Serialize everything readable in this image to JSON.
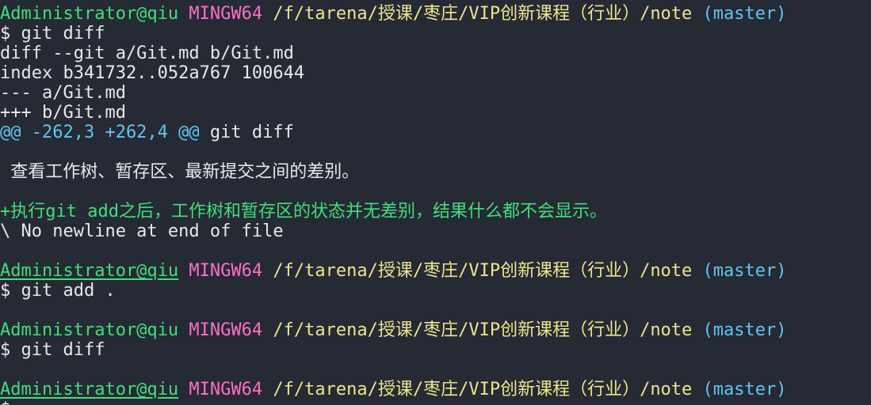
{
  "colors": {
    "background": "#262a35",
    "default_text": "#e8e8e8",
    "prompt_user": "#3fe07a",
    "prompt_msystem": "#ff6ec7",
    "prompt_path": "#eee58a",
    "prompt_branch": "#5ec8ee",
    "diff_meta": "#e8e8e8",
    "diff_hunk": "#5ec8ee",
    "diff_added": "#3fe07a"
  },
  "lines": [
    {
      "kind": "prompt",
      "segments": [
        {
          "text": "Administrator@qiu",
          "color": "prompt_user",
          "underline": false
        },
        {
          "text": " ",
          "color": "default_text"
        },
        {
          "text": "MINGW64",
          "color": "prompt_msystem"
        },
        {
          "text": " ",
          "color": "default_text"
        },
        {
          "text": "/f/tarena/授课/枣庄/VIP创新课程（行业）/note",
          "color": "prompt_path"
        },
        {
          "text": " ",
          "color": "default_text"
        },
        {
          "text": "(master)",
          "color": "prompt_branch"
        }
      ]
    },
    {
      "kind": "command",
      "segments": [
        {
          "text": "$ git diff",
          "color": "default_text"
        }
      ]
    },
    {
      "kind": "diff-meta",
      "segments": [
        {
          "text": "diff --git a/Git.md b/Git.md",
          "color": "diff_meta"
        }
      ]
    },
    {
      "kind": "diff-meta",
      "segments": [
        {
          "text": "index b341732..052a767 100644",
          "color": "diff_meta"
        }
      ]
    },
    {
      "kind": "diff-meta",
      "segments": [
        {
          "text": "--- a/Git.md",
          "color": "diff_meta"
        }
      ]
    },
    {
      "kind": "diff-meta",
      "segments": [
        {
          "text": "+++ b/Git.md",
          "color": "diff_meta"
        }
      ]
    },
    {
      "kind": "diff-hunk",
      "segments": [
        {
          "text": "@@ -262,3 +262,4 @@",
          "color": "diff_hunk"
        },
        {
          "text": " git diff",
          "color": "default_text"
        }
      ]
    },
    {
      "kind": "blank",
      "segments": []
    },
    {
      "kind": "context",
      "segments": [
        {
          "text": " 查看工作树、暂存区、最新提交之间的差别。",
          "color": "default_text"
        }
      ]
    },
    {
      "kind": "blank",
      "segments": []
    },
    {
      "kind": "added",
      "segments": [
        {
          "text": "+执行git add之后，工作树和暂存区的状态并无差别，结果什么都不会显示。",
          "color": "diff_added"
        }
      ]
    },
    {
      "kind": "note",
      "segments": [
        {
          "text": "\\ No newline at end of file",
          "color": "default_text"
        }
      ]
    },
    {
      "kind": "blank",
      "segments": []
    },
    {
      "kind": "prompt",
      "segments": [
        {
          "text": "Administrator@qiu",
          "color": "prompt_user",
          "underline": true
        },
        {
          "text": " ",
          "color": "default_text"
        },
        {
          "text": "MINGW64",
          "color": "prompt_msystem"
        },
        {
          "text": " ",
          "color": "default_text"
        },
        {
          "text": "/f/tarena/授课/枣庄/VIP创新课程（行业）/note",
          "color": "prompt_path"
        },
        {
          "text": " ",
          "color": "default_text"
        },
        {
          "text": "(master)",
          "color": "prompt_branch"
        }
      ]
    },
    {
      "kind": "command",
      "segments": [
        {
          "text": "$ git add .",
          "color": "default_text"
        }
      ]
    },
    {
      "kind": "blank",
      "segments": []
    },
    {
      "kind": "prompt",
      "segments": [
        {
          "text": "Administrator@qiu",
          "color": "prompt_user",
          "underline": false
        },
        {
          "text": " ",
          "color": "default_text"
        },
        {
          "text": "MINGW64",
          "color": "prompt_msystem"
        },
        {
          "text": " ",
          "color": "default_text"
        },
        {
          "text": "/f/tarena/授课/枣庄/VIP创新课程（行业）/note",
          "color": "prompt_path"
        },
        {
          "text": " ",
          "color": "default_text"
        },
        {
          "text": "(master)",
          "color": "prompt_branch"
        }
      ]
    },
    {
      "kind": "command",
      "segments": [
        {
          "text": "$ git diff",
          "color": "default_text"
        }
      ]
    },
    {
      "kind": "blank",
      "segments": []
    },
    {
      "kind": "prompt",
      "segments": [
        {
          "text": "Administrator@qiu",
          "color": "prompt_user",
          "underline": true
        },
        {
          "text": " ",
          "color": "default_text"
        },
        {
          "text": "MINGW64",
          "color": "prompt_msystem"
        },
        {
          "text": " ",
          "color": "default_text"
        },
        {
          "text": "/f/tarena/授课/枣庄/VIP创新课程（行业）/note",
          "color": "prompt_path"
        },
        {
          "text": " ",
          "color": "default_text"
        },
        {
          "text": "(master)",
          "color": "prompt_branch"
        }
      ]
    },
    {
      "kind": "command",
      "segments": [
        {
          "text": "$",
          "color": "default_text"
        }
      ]
    }
  ]
}
